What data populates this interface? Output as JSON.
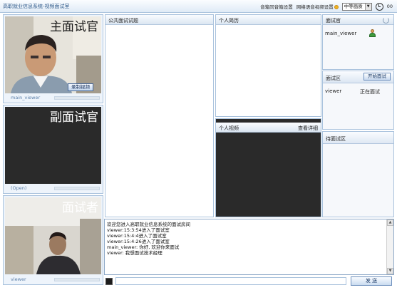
{
  "window": {
    "title": "高职就业信息系统-视频面试室"
  },
  "topbar": {
    "audio_link": "音箱同音箱设置",
    "video_link": "网络语音视频设置",
    "quality_select": "中等画质",
    "timer": "00"
  },
  "videos": {
    "main": {
      "role": "主面试官",
      "name": "main_viewer",
      "record_button": "录制视频"
    },
    "vice": {
      "role": "副面试官",
      "name": "(Open)"
    },
    "candidate": {
      "role": "面试者",
      "name": "viewer"
    }
  },
  "panels": {
    "public_questions": {
      "title": "公共面试试题"
    },
    "resume": {
      "title": "个人简历"
    },
    "personal_video": {
      "title": "个人视频",
      "detail_link": "查看详细"
    },
    "interviewers": {
      "title": "面试官",
      "items": [
        {
          "name": "main_viewer"
        }
      ]
    },
    "interview_area": {
      "title": "面试区",
      "start_button": "开始面试",
      "items": [
        {
          "name": "viewer",
          "status": "正在面试"
        }
      ]
    },
    "waiting_area": {
      "title": "待面试区"
    }
  },
  "chat": {
    "lines": [
      "欢迎您进入高职就业信息系统的面试房间",
      "viewer:15:3:54进入了面试室",
      "viewer:15:4:4进入了面试室",
      "viewer:15:4:26进入了面试室",
      "main_viewer: 你好, 欢迎你来面试",
      "viewer: 我想面试技术经理"
    ],
    "input_value": "",
    "send_button": "发 送"
  },
  "colors": {
    "title_text": "#2f5a8a",
    "panel_border": "#a9c2dd",
    "panel_header": "#dbe6f2",
    "video_dark": "#2a2a2a"
  }
}
